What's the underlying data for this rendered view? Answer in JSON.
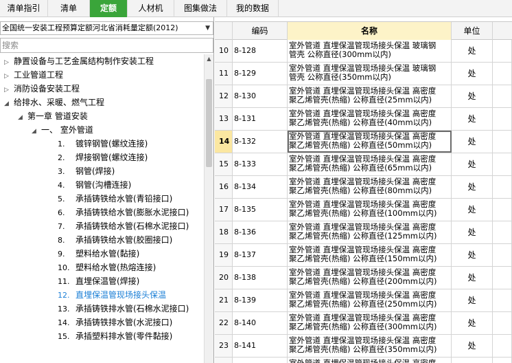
{
  "tabs": [
    {
      "label": "清单指引",
      "active": false
    },
    {
      "label": "清单",
      "active": false
    },
    {
      "label": "定额",
      "active": true
    },
    {
      "label": "人材机",
      "active": false
    },
    {
      "label": "图集做法",
      "active": false
    },
    {
      "label": "我的数据",
      "active": false
    }
  ],
  "quota_library": {
    "selected": "全国统一安装工程预算定额河北省消耗量定额(2012)"
  },
  "search": {
    "placeholder": "搜索",
    "value": ""
  },
  "tree": [
    {
      "label": "静置设备与工艺金属结构制作安装工程",
      "level": 0,
      "expanded": false
    },
    {
      "label": "工业管道工程",
      "level": 0,
      "expanded": false
    },
    {
      "label": "消防设备安装工程",
      "level": 0,
      "expanded": false
    },
    {
      "label": "给排水、采暖、燃气工程",
      "level": 0,
      "expanded": true
    },
    {
      "label": "第一章 管道安装",
      "level": 1,
      "expanded": true
    },
    {
      "label": "一、 室外管道",
      "level": 2,
      "expanded": true
    },
    {
      "num": "1.",
      "label": "镀锌钢管(螺纹连接)",
      "level": 3
    },
    {
      "num": "2.",
      "label": "焊接钢管(螺纹连接)",
      "level": 3
    },
    {
      "num": "3.",
      "label": "钢管(焊接)",
      "level": 3
    },
    {
      "num": "4.",
      "label": "钢管(沟槽连接)",
      "level": 3
    },
    {
      "num": "5.",
      "label": "承插铸铁给水管(青铅接口)",
      "level": 3
    },
    {
      "num": "6.",
      "label": "承插铸铁给水管(膨胀水泥接口)",
      "level": 3
    },
    {
      "num": "7.",
      "label": "承插铸铁给水管(石棉水泥接口)",
      "level": 3
    },
    {
      "num": "8.",
      "label": "承插铸铁给水管(胶圈接口)",
      "level": 3
    },
    {
      "num": "9.",
      "label": "塑料给水管(黏接)",
      "level": 3
    },
    {
      "num": "10.",
      "label": "塑料给水管(热熔连接)",
      "level": 3
    },
    {
      "num": "11.",
      "label": "直埋保温管(焊接)",
      "level": 3
    },
    {
      "num": "12.",
      "label": "直埋保温管现场接头保温",
      "level": 3,
      "selected": true
    },
    {
      "num": "13.",
      "label": "承插铸铁排水管(石棉水泥接口)",
      "level": 3
    },
    {
      "num": "14.",
      "label": "承插铸铁排水管(水泥接口)",
      "level": 3
    },
    {
      "num": "15.",
      "label": "承插塑料排水管(零件黏接)",
      "level": 3
    }
  ],
  "table": {
    "headers": {
      "code": "编码",
      "name": "名称",
      "unit": "单位"
    },
    "rows": [
      {
        "idx": "10",
        "code": "8-128",
        "name1": "室外管道 直埋保温管现场接头保温 玻璃钢",
        "name2": "管壳 公称直径(300mm以内)",
        "unit": "处"
      },
      {
        "idx": "11",
        "code": "8-129",
        "name1": "室外管道 直埋保温管现场接头保温 玻璃钢",
        "name2": "管壳 公称直径(350mm以内)",
        "unit": "处"
      },
      {
        "idx": "12",
        "code": "8-130",
        "name1": "室外管道 直埋保温管现场接头保温 高密度",
        "name2": "聚乙烯管壳(热缩) 公称直径(25mm以内)",
        "unit": "处"
      },
      {
        "idx": "13",
        "code": "8-131",
        "name1": "室外管道 直埋保温管现场接头保温 高密度",
        "name2": "聚乙烯管壳(热缩) 公称直径(40mm以内)",
        "unit": "处"
      },
      {
        "idx": "14",
        "code": "8-132",
        "name1": "室外管道 直埋保温管现场接头保温 高密度",
        "name2": "聚乙烯管壳(热缩) 公称直径(50mm以内)",
        "unit": "处",
        "current": true
      },
      {
        "idx": "15",
        "code": "8-133",
        "name1": "室外管道 直埋保温管现场接头保温 高密度",
        "name2": "聚乙烯管壳(热缩) 公称直径(65mm以内)",
        "unit": "处"
      },
      {
        "idx": "16",
        "code": "8-134",
        "name1": "室外管道 直埋保温管现场接头保温 高密度",
        "name2": "聚乙烯管壳(热缩) 公称直径(80mm以内)",
        "unit": "处"
      },
      {
        "idx": "17",
        "code": "8-135",
        "name1": "室外管道 直埋保温管现场接头保温 高密度",
        "name2": "聚乙烯管壳(热缩) 公称直径(100mm以内)",
        "unit": "处"
      },
      {
        "idx": "18",
        "code": "8-136",
        "name1": "室外管道 直埋保温管现场接头保温 高密度",
        "name2": "聚乙烯管壳(热缩) 公称直径(125mm以内)",
        "unit": "处"
      },
      {
        "idx": "19",
        "code": "8-137",
        "name1": "室外管道 直埋保温管现场接头保温 高密度",
        "name2": "聚乙烯管壳(热缩) 公称直径(150mm以内)",
        "unit": "处"
      },
      {
        "idx": "20",
        "code": "8-138",
        "name1": "室外管道 直埋保温管现场接头保温 高密度",
        "name2": "聚乙烯管壳(热缩) 公称直径(200mm以内)",
        "unit": "处"
      },
      {
        "idx": "21",
        "code": "8-139",
        "name1": "室外管道 直埋保温管现场接头保温 高密度",
        "name2": "聚乙烯管壳(热缩) 公称直径(250mm以内)",
        "unit": "处"
      },
      {
        "idx": "22",
        "code": "8-140",
        "name1": "室外管道 直埋保温管现场接头保温 高密度",
        "name2": "聚乙烯管壳(热缩) 公称直径(300mm以内)",
        "unit": "处"
      },
      {
        "idx": "23",
        "code": "8-141",
        "name1": "室外管道 直埋保温管现场接头保温 高密度",
        "name2": "聚乙烯管壳(热缩) 公称直径(350mm以内)",
        "unit": "处"
      },
      {
        "idx": "",
        "code": "",
        "name1": "室外管道 直埋保温管现场接头保温 高密度",
        "name2": "",
        "unit": ""
      }
    ]
  },
  "icons": {
    "expand": "triangle-right-icon",
    "collapse": "triangle-down-icon",
    "dropdown": "chevron-down-icon"
  },
  "colors": {
    "active_tab": "#3aa53a",
    "name_header": "#fdf3c8",
    "selected_tree": "#1b7fd6",
    "current_row_index": "#fbe7a1"
  }
}
